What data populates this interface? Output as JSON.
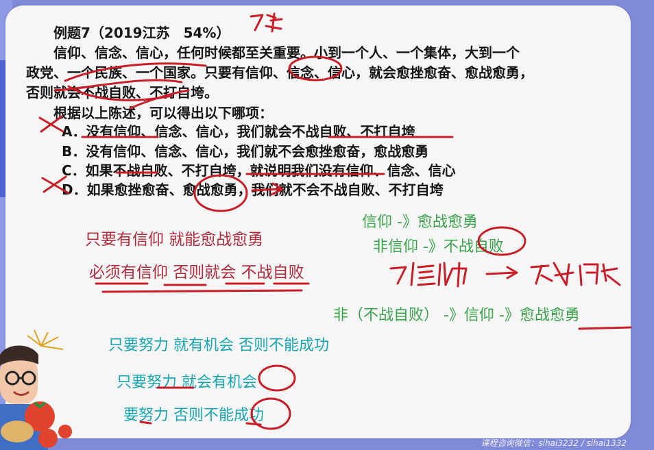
{
  "question": {
    "title": "例题7（2019江苏　54%）",
    "stem_lines": [
      "信仰、信念、信心，任何时候都至关重要。小到一个人、一个集体，大到一个",
      "政党、一个民族、一个国家。只要有信仰、信念、信心，就会愈挫愈奋、愈战愈勇，",
      "否则就会不战自败、不打自垮。"
    ],
    "prompt": "根据以上陈述，可以得出以下哪项：",
    "options": [
      "A．没有信仰、信念、信心，我们就会不战自败、不打自垮",
      "B．没有信仰、信念、信心，我们就不会愈挫愈奋，愈战愈勇",
      "C．如果不战自败、不打自垮，就说明我们没有信仰、信念、信心",
      "D．如果愈挫愈奋、愈战愈勇，我们就不会不战自败、不打自垮"
    ]
  },
  "notes": {
    "red": [
      "只要有信仰 就能愈战愈勇",
      "必须有信仰 否则就会  不战自败"
    ],
    "green": [
      "信仰 -》愈战愈勇",
      "非信仰 -》不战自败",
      "非（不战自败） -》信仰 -》愈战愈勇"
    ],
    "teal": [
      "只要努力 就有机会 否则不能成功",
      "只要努力 就会有机会",
      "要努力 否则不能成功"
    ]
  },
  "handwriting": {
    "mark_1": "7条",
    "mark_2": "7信仰 → 不战自败"
  },
  "watermark": "课程咨询微信：sihai3232 / sihai1332",
  "colors": {
    "annotation_red": "#c81e28",
    "note_red": "#b12a3c",
    "note_green": "#3aa44a",
    "note_teal": "#18a6b3",
    "background": "#7f8ad8",
    "board": "#f6f6f6"
  }
}
